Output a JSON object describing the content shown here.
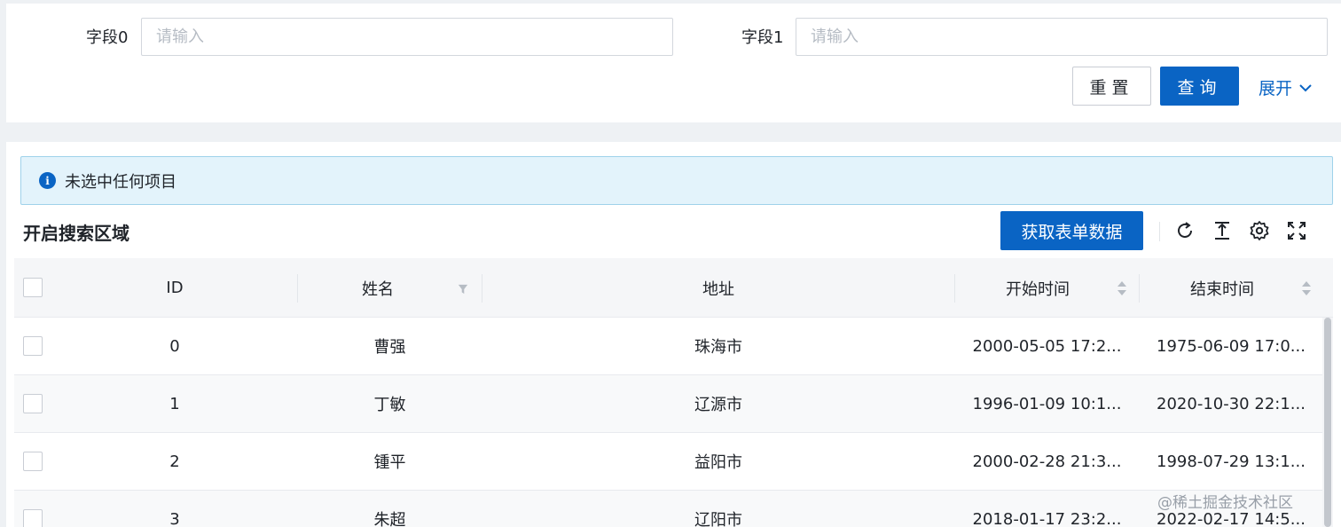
{
  "search": {
    "fields": [
      {
        "label": "字段0",
        "placeholder": "请输入",
        "value": ""
      },
      {
        "label": "字段1",
        "placeholder": "请输入",
        "value": ""
      }
    ],
    "reset_label": "重置",
    "query_label": "查询",
    "expand_label": "展开"
  },
  "alert": {
    "text": "未选中任何项目"
  },
  "table": {
    "title": "开启搜索区域",
    "fetch_label": "获取表单数据",
    "columns": [
      "ID",
      "姓名",
      "地址",
      "开始时间",
      "结束时间"
    ],
    "rows": [
      {
        "id": "0",
        "name": "曹强",
        "address": "珠海市",
        "start": "2000-05-05 17:2...",
        "end": "1975-06-09 17:0..."
      },
      {
        "id": "1",
        "name": "丁敏",
        "address": "辽源市",
        "start": "1996-01-09 10:1...",
        "end": "2020-10-30 22:1..."
      },
      {
        "id": "2",
        "name": "锺平",
        "address": "益阳市",
        "start": "2000-02-28 21:3...",
        "end": "1998-07-29 13:1..."
      },
      {
        "id": "3",
        "name": "朱超",
        "address": "辽阳市",
        "start": "2018-01-17 23:2...",
        "end": "2022-02-17 14:5..."
      }
    ]
  },
  "watermark": "@稀土掘金技术社区",
  "colors": {
    "primary": "#0a64c4",
    "alert_bg": "#e3f3fb",
    "page_bg": "#eef1f4"
  },
  "icons": [
    "chevron-down-icon",
    "info-icon",
    "refresh-icon",
    "column-height-icon",
    "settings-icon",
    "fullscreen-icon",
    "filter-icon",
    "sort-icon"
  ]
}
